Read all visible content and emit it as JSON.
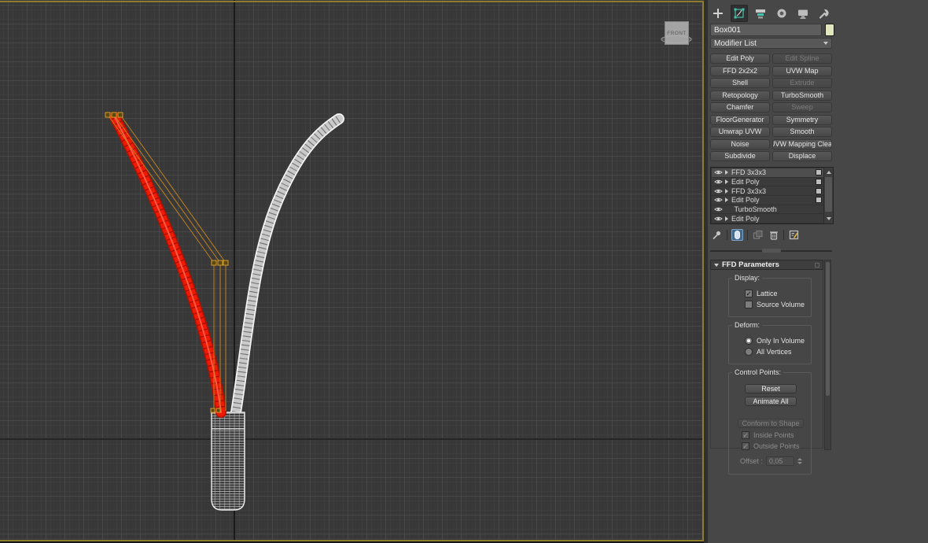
{
  "viewport": {
    "viewcube_label": "FRONT",
    "border_color": "#8d7c2e",
    "selection_color": "#e41804",
    "lattice_color": "#c08120",
    "wireframe_color": "#e3e3e3"
  },
  "icons": {
    "check": "✓",
    "tab_icons": [
      "create-plus-icon",
      "modify-tab-icon",
      "hierarchy-tab-icon",
      "motion-tab-icon",
      "display-tab-icon",
      "utilities-wrench-icon"
    ],
    "stack_tool_icons": [
      "pin-stack-icon",
      "show-end-result-icon",
      "make-unique-icon",
      "remove-modifier-trash-icon",
      "configure-modifier-sets-icon"
    ]
  },
  "command_panel": {
    "object_name": "Box001",
    "modifier_list_label": "Modifier List",
    "modifier_buttons": [
      {
        "label": "Edit Poly",
        "enabled": true
      },
      {
        "label": "Edit Spline",
        "enabled": false
      },
      {
        "label": "FFD 2x2x2",
        "enabled": true
      },
      {
        "label": "UVW Map",
        "enabled": true
      },
      {
        "label": "Shell",
        "enabled": true
      },
      {
        "label": "Extrude",
        "enabled": false
      },
      {
        "label": "Retopology",
        "enabled": true
      },
      {
        "label": "TurboSmooth",
        "enabled": true
      },
      {
        "label": "Chamfer",
        "enabled": true
      },
      {
        "label": "Sweep",
        "enabled": false
      },
      {
        "label": "FloorGenerator",
        "enabled": true
      },
      {
        "label": "Symmetry",
        "enabled": true
      },
      {
        "label": "Unwrap UVW",
        "enabled": true
      },
      {
        "label": "Smooth",
        "enabled": true
      },
      {
        "label": "Noise",
        "enabled": true
      },
      {
        "label": "UVW Mapping Clear",
        "enabled": true
      },
      {
        "label": "Subdivide",
        "enabled": true
      },
      {
        "label": "Displace",
        "enabled": true
      }
    ],
    "modifier_stack": [
      {
        "label": "FFD 3x3x3",
        "selected": true,
        "expandable": true,
        "toggle": true
      },
      {
        "label": "Edit Poly",
        "selected": false,
        "expandable": true,
        "toggle": true
      },
      {
        "label": "FFD 3x3x3",
        "selected": false,
        "expandable": true,
        "toggle": true
      },
      {
        "label": "Edit Poly",
        "selected": false,
        "expandable": true,
        "toggle": true
      },
      {
        "label": "TurboSmooth",
        "selected": false,
        "expandable": false,
        "toggle": false
      },
      {
        "label": "Edit Poly",
        "selected": false,
        "expandable": true,
        "toggle": false
      }
    ],
    "rollout": {
      "title": "FFD Parameters",
      "display_group": {
        "legend": "Display:",
        "lattice_label": "Lattice",
        "lattice_checked": true,
        "source_volume_label": "Source Volume",
        "source_volume_checked": false
      },
      "deform_group": {
        "legend": "Deform:",
        "only_in_volume_label": "Only In Volume",
        "only_in_volume_selected": true,
        "all_vertices_label": "All Vertices",
        "all_vertices_selected": false
      },
      "control_points_group": {
        "legend": "Control Points:",
        "reset_label": "Reset",
        "animate_all_label": "Animate All",
        "conform_to_shape_label": "Conform to Shape",
        "inside_points_label": "Inside Points",
        "inside_points_checked": true,
        "outside_points_label": "Outside Points",
        "outside_points_checked": true,
        "offset_label": "Offset :",
        "offset_value": "0,05"
      }
    }
  }
}
